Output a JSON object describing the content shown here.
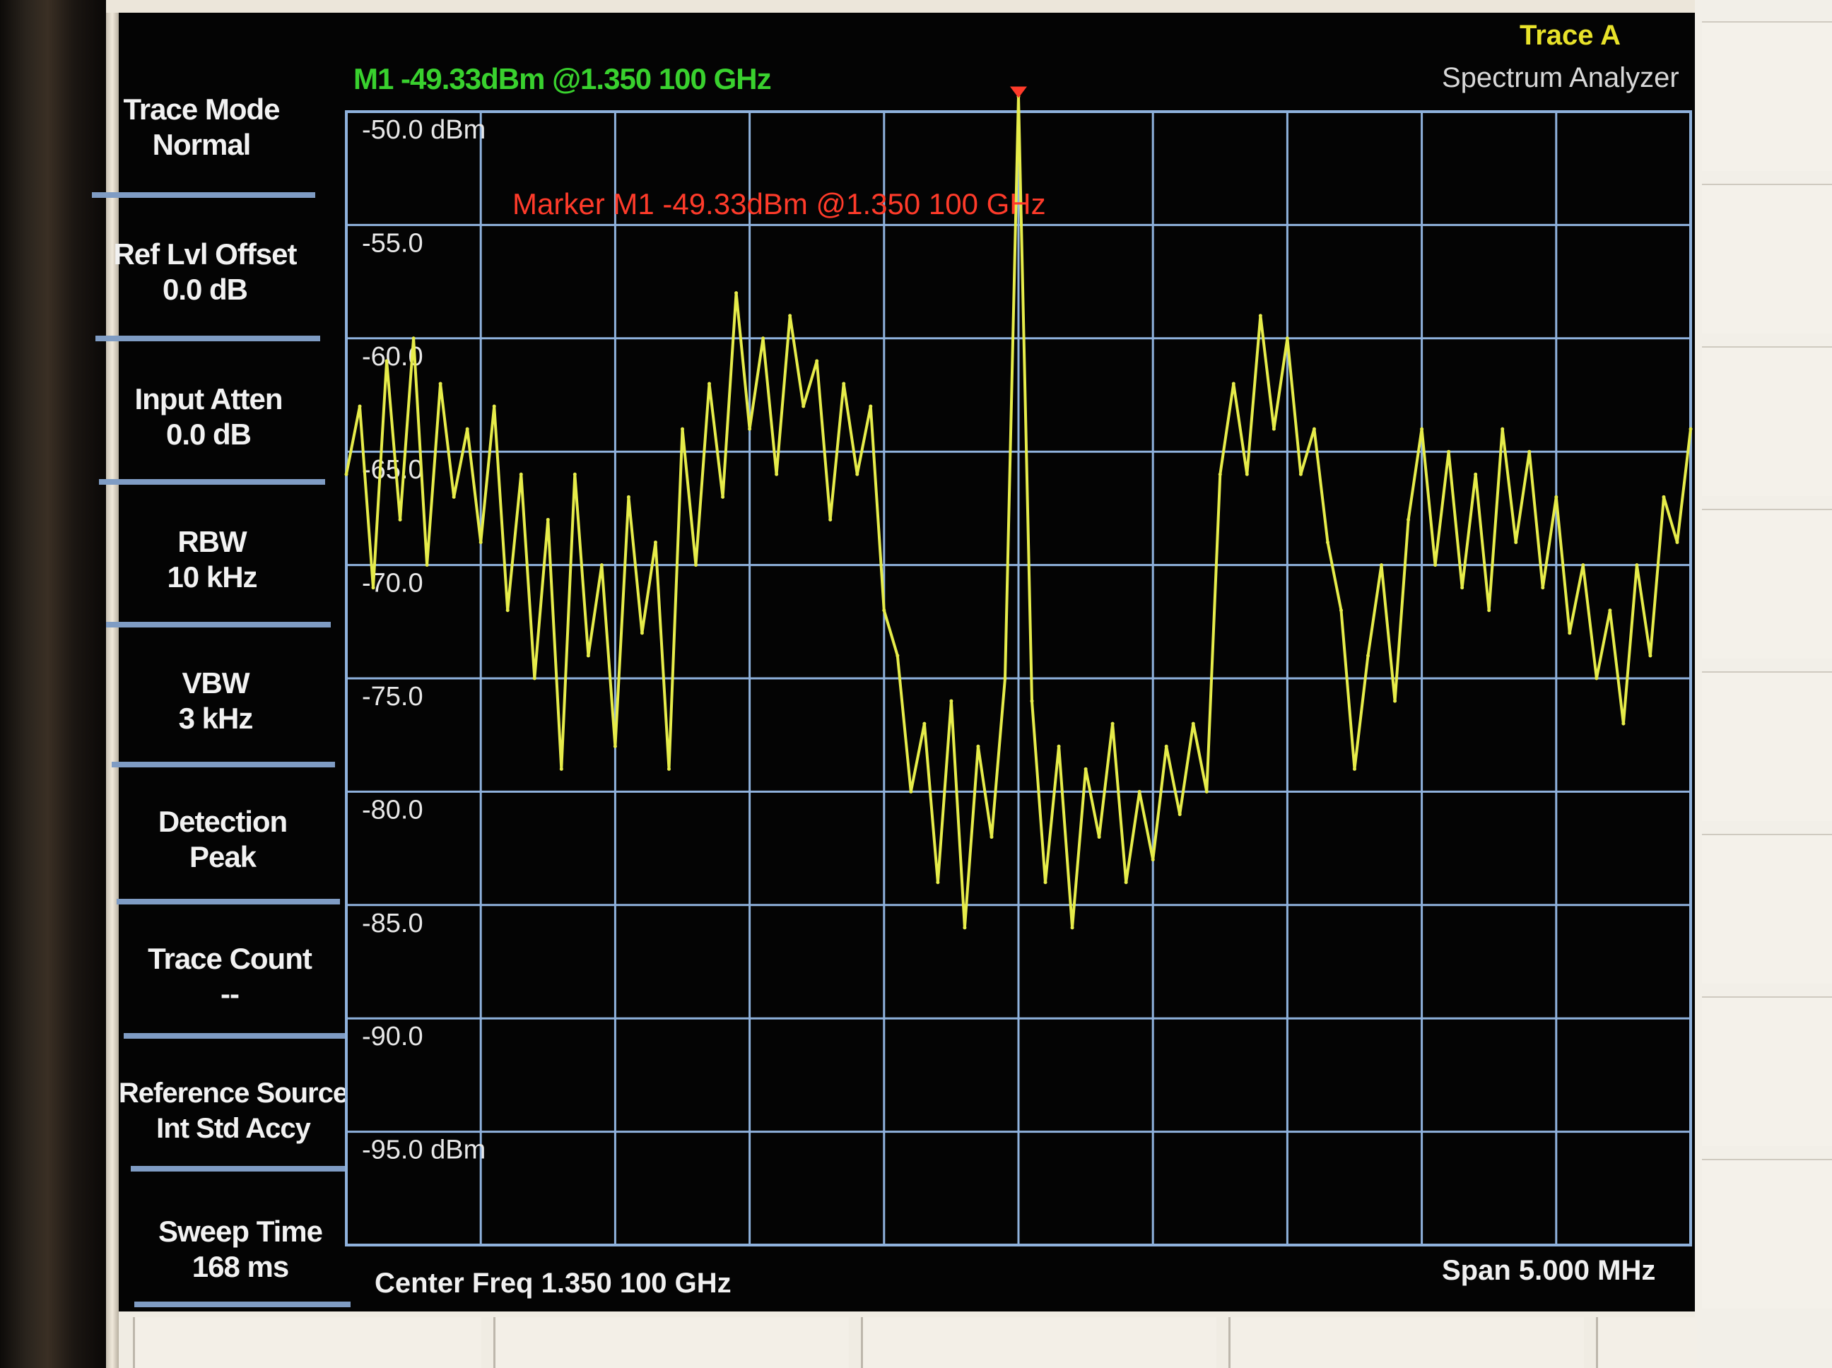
{
  "instrument": {
    "trace_title": "Trace A",
    "mode_title": "Spectrum Analyzer",
    "marker_readout": "M1 -49.33dBm @1.350 100 GHz",
    "marker_annotation": "Marker M1 -49.33dBm @1.350 100 GHz",
    "center_freq": "Center Freq 1.350 100 GHz",
    "span": "Span 5.000 MHz"
  },
  "softkeys": [
    {
      "title": "Trace Mode",
      "value": "Normal"
    },
    {
      "title": "Ref Lvl Offset",
      "value": "0.0 dB"
    },
    {
      "title": "Input Atten",
      "value": "0.0 dB"
    },
    {
      "title": "RBW",
      "value": "10 kHz"
    },
    {
      "title": "VBW",
      "value": "3 kHz"
    },
    {
      "title": "Detection",
      "value": "Peak"
    },
    {
      "title": "Trace Count",
      "value": "--"
    },
    {
      "title": "Reference Source",
      "value": "Int Std Accy"
    },
    {
      "title": "Sweep Time",
      "value": "168 ms"
    }
  ],
  "colors": {
    "trace": "#e6ec4a",
    "grid": "#8fb2dd",
    "marker_readout": "#39d12e",
    "marker_annotation": "#ff3b2a",
    "trace_title": "#e8e22a",
    "screen_bg": "#040404"
  },
  "chart_data": {
    "type": "line",
    "x_unit": "MHz offset from center",
    "x_range": [
      -2.5,
      2.5
    ],
    "y_unit": "dBm",
    "ylim": [
      -100,
      -50
    ],
    "y_tick_labels": [
      "-50.0 dBm",
      "-55.0",
      "-60.0",
      "-65.0",
      "-70.0",
      "-75.0",
      "-80.0",
      "-85.0",
      "-90.0",
      "-95.0 dBm"
    ],
    "y_tick_values": [
      -50,
      -55,
      -60,
      -65,
      -70,
      -75,
      -80,
      -85,
      -90,
      -95
    ],
    "x_divisions": 10,
    "marker": {
      "name": "M1",
      "x": 0.0,
      "y": -49.33
    },
    "series": [
      {
        "x": [
          -2.5,
          -2.45,
          -2.4,
          -2.35,
          -2.3,
          -2.25,
          -2.2,
          -2.15,
          -2.1,
          -2.05,
          -2.0,
          -1.95,
          -1.9,
          -1.85,
          -1.8,
          -1.75,
          -1.7,
          -1.65,
          -1.6,
          -1.55,
          -1.5,
          -1.45,
          -1.4,
          -1.35,
          -1.3,
          -1.25,
          -1.2,
          -1.15,
          -1.1,
          -1.05,
          -1.0,
          -0.95,
          -0.9,
          -0.85,
          -0.8,
          -0.75,
          -0.7,
          -0.65,
          -0.6,
          -0.55,
          -0.5,
          -0.45,
          -0.4,
          -0.35,
          -0.3,
          -0.25,
          -0.2,
          -0.15,
          -0.1,
          -0.05,
          0.0,
          0.05,
          0.1,
          0.15,
          0.2,
          0.25,
          0.3,
          0.35,
          0.4,
          0.45,
          0.5,
          0.55,
          0.6,
          0.65,
          0.7,
          0.75,
          0.8,
          0.85,
          0.9,
          0.95,
          1.0,
          1.05,
          1.1,
          1.15,
          1.2,
          1.25,
          1.3,
          1.35,
          1.4,
          1.45,
          1.5,
          1.55,
          1.6,
          1.65,
          1.7,
          1.75,
          1.8,
          1.85,
          1.9,
          1.95,
          2.0,
          2.05,
          2.1,
          2.15,
          2.2,
          2.25,
          2.3,
          2.35,
          2.4,
          2.45,
          2.5
        ],
        "values": [
          -66,
          -63,
          -71,
          -61,
          -68,
          -60,
          -70,
          -62,
          -67,
          -64,
          -69,
          -63,
          -72,
          -66,
          -75,
          -68,
          -79,
          -66,
          -74,
          -70,
          -78,
          -67,
          -73,
          -69,
          -79,
          -64,
          -70,
          -62,
          -67,
          -58,
          -64,
          -60,
          -66,
          -59,
          -63,
          -61,
          -68,
          -62,
          -66,
          -63,
          -72,
          -74,
          -80,
          -77,
          -84,
          -76,
          -86,
          -78,
          -82,
          -75,
          -49.33,
          -76,
          -84,
          -78,
          -86,
          -79,
          -82,
          -77,
          -84,
          -80,
          -83,
          -78,
          -81,
          -77,
          -80,
          -66,
          -62,
          -66,
          -59,
          -64,
          -60,
          -66,
          -64,
          -69,
          -72,
          -79,
          -74,
          -70,
          -76,
          -68,
          -64,
          -70,
          -65,
          -71,
          -66,
          -72,
          -64,
          -69,
          -65,
          -71,
          -67,
          -73,
          -70,
          -75,
          -72,
          -77,
          -70,
          -74,
          -67,
          -69,
          -64
        ]
      }
    ]
  }
}
